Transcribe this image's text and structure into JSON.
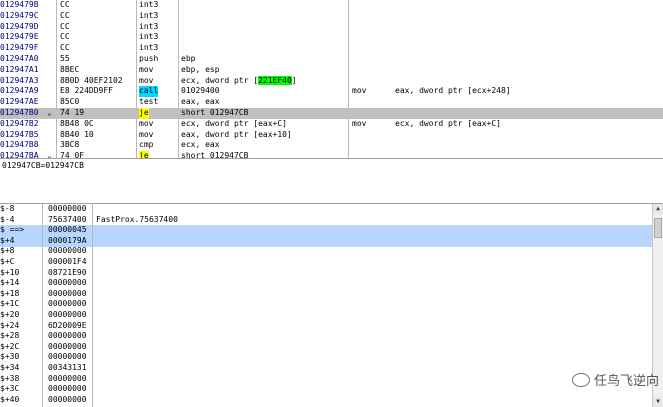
{
  "colors": {
    "call_highlight": "#00d8ff",
    "jump_highlight": "#ffff00",
    "address_highlight": "#00ff00",
    "selected_row": "#c0c0c0",
    "stack_highlight": "#b6d6ff",
    "address_text": "#000080"
  },
  "disasm": {
    "rows": [
      {
        "addr": "0129479B",
        "hex": "CC",
        "mnem": "int3",
        "ops": "",
        "cmt": "",
        "cmt2": ""
      },
      {
        "addr": "0129479C",
        "hex": "CC",
        "mnem": "int3",
        "ops": "",
        "cmt": "",
        "cmt2": ""
      },
      {
        "addr": "0129479D",
        "hex": "CC",
        "mnem": "int3",
        "ops": "",
        "cmt": "",
        "cmt2": ""
      },
      {
        "addr": "0129479E",
        "hex": "CC",
        "mnem": "int3",
        "ops": "",
        "cmt": "",
        "cmt2": ""
      },
      {
        "addr": "0129479F",
        "hex": "CC",
        "mnem": "int3",
        "ops": "",
        "cmt": "",
        "cmt2": ""
      },
      {
        "addr": "012947A0",
        "hex": "55",
        "mnem": "push",
        "ops": "ebp",
        "cmt": "",
        "cmt2": ""
      },
      {
        "addr": "012947A1",
        "hex": "8BEC",
        "mnem": "mov",
        "ops": "ebp, esp",
        "cmt": "",
        "cmt2": ""
      },
      {
        "addr": "012947A3",
        "hex": "8B0D 40EF2102",
        "mnem": "mov",
        "ops": "ecx, dword ptr [",
        "ops_hl": "221EF40",
        "ops_end": "]",
        "cmt": "",
        "cmt2": ""
      },
      {
        "addr": "012947A9",
        "hex": "E8 224DD9FF",
        "mnem": "call",
        "ops": "01029400",
        "cmt": "mov",
        "cmt2": "eax, dword ptr [ecx+248]"
      },
      {
        "addr": "012947AE",
        "hex": "85C0",
        "mnem": "test",
        "ops": "eax, eax",
        "cmt": "",
        "cmt2": ""
      },
      {
        "addr": "012947B0",
        "hex": "74 19",
        "mnem": "je",
        "ops": "short 012947CB",
        "cmt": "",
        "cmt2": ""
      },
      {
        "addr": "012947B2",
        "hex": "8B48 0C",
        "mnem": "mov",
        "ops": "ecx, dword ptr [eax+C]",
        "cmt": "mov",
        "cmt2": "ecx, dword ptr [eax+C]"
      },
      {
        "addr": "012947B5",
        "hex": "8B40 10",
        "mnem": "mov",
        "ops": "eax, dword ptr [eax+10]",
        "cmt": "",
        "cmt2": ""
      },
      {
        "addr": "012947B8",
        "hex": "3BC8",
        "mnem": "cmp",
        "ops": "ecx, eax",
        "cmt": "",
        "cmt2": ""
      },
      {
        "addr": "012947BA",
        "hex": "74 0F",
        "mnem": "je",
        "ops": "short 012947CB",
        "cmt": "",
        "cmt2": ""
      }
    ]
  },
  "info": {
    "text": "012947CB=012947CB"
  },
  "stack": {
    "rows": [
      {
        "off": "$-8",
        "val": "00000000",
        "cmt": ""
      },
      {
        "off": "$-4",
        "val": "75637400",
        "cmt": "FastProx.75637400"
      },
      {
        "off": "$ ==>",
        "val": "00000045",
        "cmt": ""
      },
      {
        "off": "$+4",
        "val": "0000179A",
        "cmt": ""
      },
      {
        "off": "$+8",
        "val": "00000000",
        "cmt": ""
      },
      {
        "off": "$+C",
        "val": "000001F4",
        "cmt": ""
      },
      {
        "off": "$+10",
        "val": "08721E90",
        "cmt": ""
      },
      {
        "off": "$+14",
        "val": "00000000",
        "cmt": ""
      },
      {
        "off": "$+18",
        "val": "00000000",
        "cmt": ""
      },
      {
        "off": "$+1C",
        "val": "00000000",
        "cmt": ""
      },
      {
        "off": "$+20",
        "val": "00000000",
        "cmt": ""
      },
      {
        "off": "$+24",
        "val": "6D20009E",
        "cmt": ""
      },
      {
        "off": "$+28",
        "val": "00000000",
        "cmt": ""
      },
      {
        "off": "$+2C",
        "val": "00000000",
        "cmt": ""
      },
      {
        "off": "$+30",
        "val": "00000000",
        "cmt": ""
      },
      {
        "off": "$+34",
        "val": "00343131",
        "cmt": ""
      },
      {
        "off": "$+38",
        "val": "00000000",
        "cmt": ""
      },
      {
        "off": "$+3C",
        "val": "00000000",
        "cmt": ""
      },
      {
        "off": "$+40",
        "val": "00000000",
        "cmt": ""
      }
    ]
  },
  "watermark": {
    "text": "任鸟飞逆向"
  }
}
